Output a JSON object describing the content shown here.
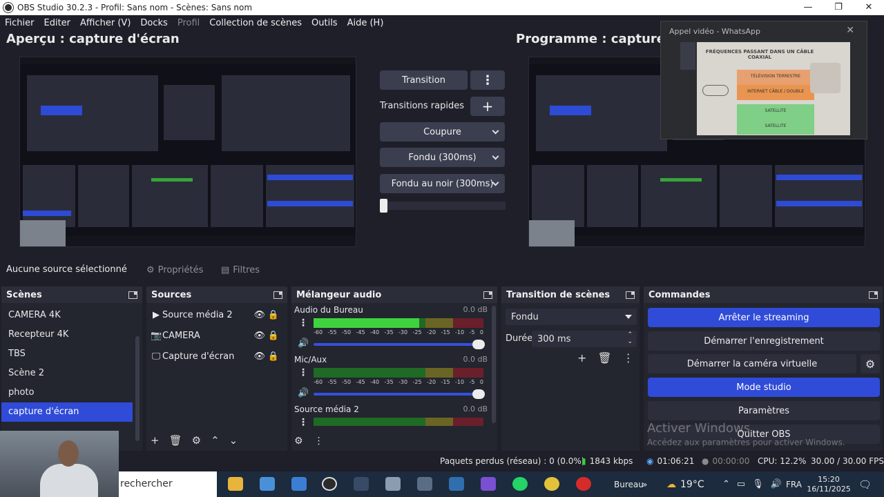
{
  "window": {
    "title": "OBS Studio 30.2.3 - Profil: Sans nom - Scènes: Sans nom"
  },
  "menu": [
    "Fichier",
    "Editer",
    "Afficher (V)",
    "Docks",
    "Profil",
    "Collection de scènes",
    "Outils",
    "Aide (H)"
  ],
  "preview": {
    "title": "Aperçu : capture d'écran"
  },
  "program": {
    "title": "Programme : capture d"
  },
  "transition": {
    "button": "Transition",
    "quick_label": "Transitions rapides",
    "items": [
      "Coupure",
      "Fondu (300ms)",
      "Fondu au noir (300ms)"
    ]
  },
  "whatsapp": {
    "title": "Appel vidéo - WhatsApp",
    "heading": "FRÉQUENCES PASSANT DANS UN CÂBLE COAXIAL",
    "bands": [
      "TÉLÉVISION TERRESTRE",
      "INTERNET CÂBLE / DOUBLE",
      "SATELLITE",
      "SATELLITE"
    ],
    "band_colors": [
      "#e8a070",
      "#e9944f",
      "#7fcf86",
      "#7fcf86"
    ]
  },
  "status": {
    "no_source": "Aucune source sélectionné",
    "properties": "Propriétés",
    "filters": "Filtres"
  },
  "scenes": {
    "title": "Scènes",
    "items": [
      "CAMERA 4K",
      "Recepteur 4K",
      "TBS",
      "Scène 2",
      "photo",
      "capture d'écran"
    ],
    "selected_index": 5
  },
  "sources": {
    "title": "Sources",
    "items": [
      {
        "name": "Source média 2",
        "icon": "play-icon"
      },
      {
        "name": "CAMERA",
        "icon": "camera-icon"
      },
      {
        "name": "Capture d'écran",
        "icon": "monitor-icon"
      }
    ]
  },
  "mixer": {
    "title": "Mélangeur audio",
    "channels": [
      {
        "name": "Audio du Bureau",
        "db": "0.0 dB",
        "level": 0.62,
        "volume": 1.0
      },
      {
        "name": "Mic/Aux",
        "db": "0.0 dB",
        "level": 0.0,
        "volume": 1.0
      },
      {
        "name": "Source média 2",
        "db": "0.0 dB",
        "level": 0.0,
        "volume": 1.0
      }
    ],
    "scale": [
      "-60",
      "-55",
      "-50",
      "-45",
      "-40",
      "-35",
      "-30",
      "-25",
      "-20",
      "-15",
      "-10",
      "-5",
      "0"
    ]
  },
  "scene_transitions": {
    "title": "Transition de scènes",
    "selected": "Fondu",
    "duration_label": "Durée",
    "duration_value": "300 ms"
  },
  "controls": {
    "title": "Commandes",
    "stop_streaming": "Arrêter le streaming",
    "start_recording": "Démarrer l'enregistrement",
    "start_virtual_cam": "Démarrer la caméra virtuelle",
    "studio_mode": "Mode studio",
    "settings": "Paramètres",
    "quit": "Quitter OBS"
  },
  "activation": {
    "title": "Activer Windows",
    "subtitle": "Accédez aux paramètres pour activer Windows."
  },
  "statusbar": {
    "dropped": "Paquets perdus (réseau) : 0 (0.0%)",
    "bitrate": "1843 kbps",
    "stream_time": "01:06:21",
    "rec_time": "00:00:00",
    "cpu": "CPU: 12.2%",
    "fps": "30.00 / 30.00 FPS"
  },
  "taskbar": {
    "search_placeholder": "rechercher",
    "desktop_label": "Bureau",
    "weather": "19°C",
    "lang": "FRA",
    "time": "15:20",
    "date": "16/11/2025"
  }
}
